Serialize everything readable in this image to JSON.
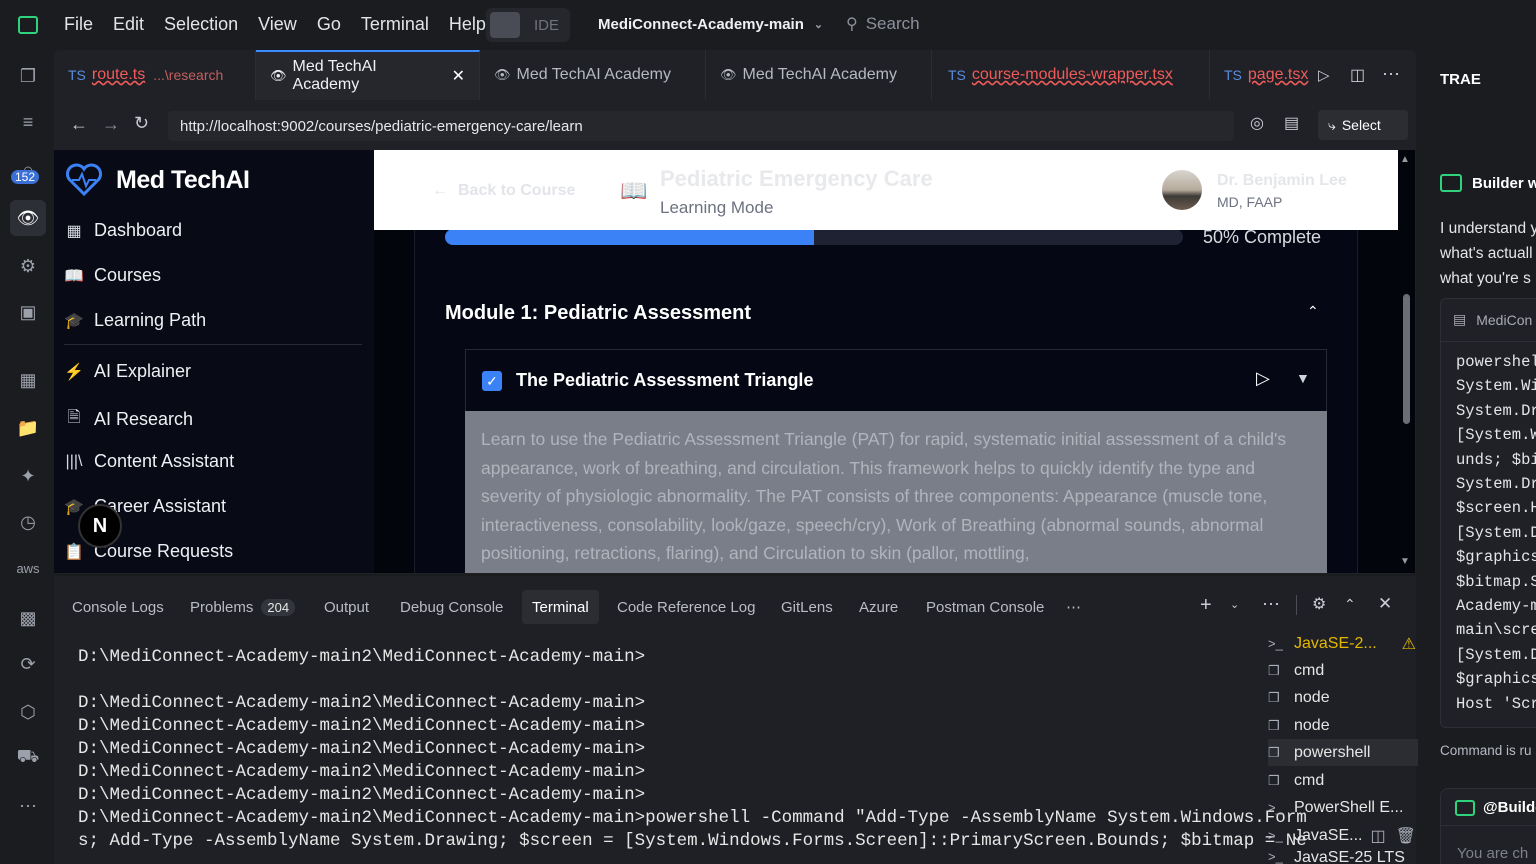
{
  "titlebar": {
    "menu": [
      "File",
      "Edit",
      "Selection",
      "View",
      "Go",
      "Terminal",
      "Help"
    ],
    "ide_label": "IDE",
    "project": "MediConnect-Academy-main",
    "search_placeholder": "Search"
  },
  "activity": {
    "badge": "152"
  },
  "tabs": [
    {
      "kind": "TS",
      "label": "route.ts",
      "hint": "...\\research"
    },
    {
      "label": "Med TechAI Academy"
    },
    {
      "label": "Med TechAI Academy"
    },
    {
      "label": "Med TechAI Academy"
    },
    {
      "kind": "TS",
      "label": "course-modules-wrapper.tsx"
    },
    {
      "kind": "TS",
      "label": "page.tsx"
    }
  ],
  "browser": {
    "url": "http://localhost:9002/courses/pediatric-emergency-care/learn",
    "select_label": "Select"
  },
  "app": {
    "brand": "Med TechAI",
    "nav": [
      "Dashboard",
      "Courses",
      "Learning Path",
      "AI Explainer",
      "AI Research",
      "Content Assistant",
      "Career Assistant",
      "Course Requests"
    ],
    "back": "Back to Course",
    "course_title": "Pediatric Emergency Care",
    "mode": "Learning Mode",
    "user_name": "Dr. Benjamin Lee",
    "user_role": "MD, FAAP",
    "progress_label": "50% Complete",
    "progress": 0.5,
    "module_title": "Module 1: Pediatric Assessment",
    "lesson_title": "The Pediatric Assessment Triangle",
    "lesson_desc": "Learn to use the Pediatric Assessment Triangle (PAT) for rapid, systematic initial assessment of a child's appearance, work of breathing, and circulation. This framework helps to quickly identify the type and severity of physiologic abnormality. The PAT consists of three components: Appearance (muscle tone, interactiveness, consolability, look/gaze, speech/cry), Work of Breathing (abnormal sounds, abnormal positioning, retractions, flaring), and Circulation to skin (pallor, mottling,"
  },
  "panel": {
    "tabs": [
      "Console Logs",
      "Problems",
      "Output",
      "Debug Console",
      "Terminal",
      "Code Reference Log",
      "GitLens",
      "Azure",
      "Postman Console"
    ],
    "problems_count": "204",
    "terminal_lines": [
      "D:\\MediConnect-Academy-main2\\MediConnect-Academy-main>",
      "",
      "D:\\MediConnect-Academy-main2\\MediConnect-Academy-main>",
      "D:\\MediConnect-Academy-main2\\MediConnect-Academy-main>",
      "D:\\MediConnect-Academy-main2\\MediConnect-Academy-main>",
      "D:\\MediConnect-Academy-main2\\MediConnect-Academy-main>",
      "D:\\MediConnect-Academy-main2\\MediConnect-Academy-main>",
      "D:\\MediConnect-Academy-main2\\MediConnect-Academy-main>powershell -Command \"Add-Type -AssemblyName System.Windows.Form",
      "s; Add-Type -AssemblyName System.Drawing; $screen = [System.Windows.Forms.Screen]::PrimaryScreen.Bounds; $bitmap = Ne"
    ],
    "terminals": [
      "JavaSE-2...",
      "cmd",
      "node",
      "node",
      "powershell",
      "cmd",
      "PowerShell E...",
      "JavaSE...",
      "JavaSE-25 LTS"
    ]
  },
  "right": {
    "title": "TRAE",
    "builder": "Builder w",
    "msg": [
      "I understand y",
      "what's actuall",
      "what you're s"
    ],
    "card_title": "MediCon",
    "code": [
      "powershel",
      "System.Wi",
      "System.Dr",
      "[System.W",
      "unds; $bi",
      "System.Dr",
      "$screen.H",
      "[System.D",
      "$graphics",
      "$bitmap.S",
      "Academy-m",
      "main\\scre",
      "[System.D",
      "$graphics",
      "Host 'Scr"
    ],
    "status": "Command is ru",
    "input_mention": "@Builde",
    "input_placeholder": "You are ch"
  },
  "colors": {
    "accent": "#3b82f6",
    "warning": "#e5b800"
  }
}
